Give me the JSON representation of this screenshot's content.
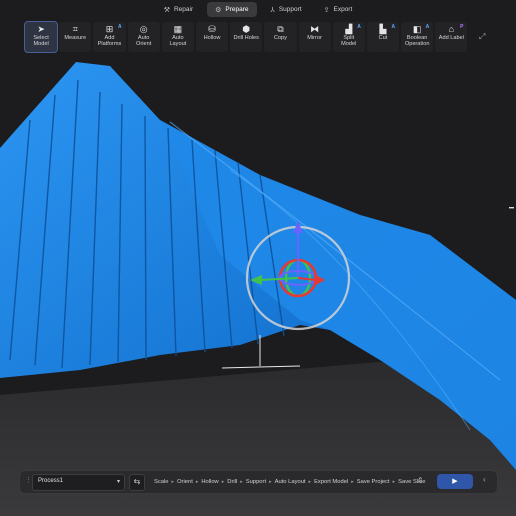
{
  "topnav": {
    "tabs": [
      {
        "label": "Repair",
        "icon": "wrench-icon",
        "glyph": "⚒",
        "active": false
      },
      {
        "label": "Prepare",
        "icon": "gear-icon",
        "glyph": "⚙",
        "active": true
      },
      {
        "label": "Support",
        "icon": "support-icon",
        "glyph": "⅄",
        "active": false
      },
      {
        "label": "Export",
        "icon": "export-icon",
        "glyph": "⇪",
        "active": false
      }
    ]
  },
  "toolbar": {
    "tools": [
      {
        "label": "Select\nModel",
        "glyph": "➤",
        "icon": "cursor-icon",
        "active": true,
        "badge": ""
      },
      {
        "label": "Measure",
        "glyph": "⌗",
        "icon": "ruler-icon",
        "active": false,
        "badge": ""
      },
      {
        "label": "Add\nPlatforms",
        "glyph": "⊞",
        "icon": "platform-icon",
        "active": false,
        "badge": "A"
      },
      {
        "label": "Auto\nOrient",
        "glyph": "◎",
        "icon": "orient-icon",
        "active": false,
        "badge": ""
      },
      {
        "label": "Auto\nLayout",
        "glyph": "▦",
        "icon": "layout-icon",
        "active": false,
        "badge": ""
      },
      {
        "label": "Hollow",
        "glyph": "⛁",
        "icon": "hollow-icon",
        "active": false,
        "badge": ""
      },
      {
        "label": "Drill Holes",
        "glyph": "⬢",
        "icon": "drill-icon",
        "active": false,
        "badge": ""
      },
      {
        "label": "Copy",
        "glyph": "⧉",
        "icon": "copy-icon",
        "active": false,
        "badge": ""
      },
      {
        "label": "Mirror",
        "glyph": "⧓",
        "icon": "mirror-icon",
        "active": false,
        "badge": ""
      },
      {
        "label": "Split\nModel",
        "glyph": "▟",
        "icon": "split-icon",
        "active": false,
        "badge": "A"
      },
      {
        "label": "Cut",
        "glyph": "▙",
        "icon": "cut-icon",
        "active": false,
        "badge": "A"
      },
      {
        "label": "Boolean\nOperation",
        "glyph": "◧",
        "icon": "boolean-icon",
        "active": false,
        "badge": "A"
      },
      {
        "label": "Add Label",
        "glyph": "⌂",
        "icon": "label-icon",
        "active": false,
        "badge": "P"
      }
    ]
  },
  "process": {
    "selected": "Process1",
    "steps": [
      "Scale",
      "Orient",
      "Hollow",
      "Drill",
      "Support",
      "Auto Layout",
      "Export Model",
      "Save Project",
      "Save Slice"
    ],
    "run_glyph": "▶"
  },
  "colors": {
    "model": "#1a7fe0",
    "axis_x": "#e53935",
    "axis_y": "#43c24a",
    "axis_z": "#6b63ff",
    "accent": "#2f56a8"
  }
}
